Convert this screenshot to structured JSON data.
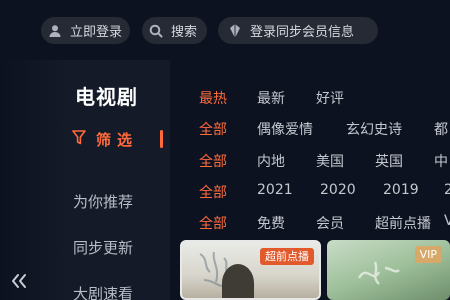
{
  "topbar": {
    "login_label": "立即登录",
    "search_label": "搜索",
    "sync_label": "登录同步会员信息"
  },
  "sidebar": {
    "title": "电视剧",
    "filter_label": "筛选",
    "items": [
      {
        "label": "为你推荐"
      },
      {
        "label": "同步更新"
      },
      {
        "label": "大剧速看"
      }
    ]
  },
  "filters": {
    "sort": [
      "最热",
      "最新",
      "好评"
    ],
    "genre": [
      "全部",
      "偶像爱情",
      "玄幻史诗",
      "都"
    ],
    "region": [
      "全部",
      "内地",
      "美国",
      "英国",
      "中"
    ],
    "year": [
      "全部",
      "2021",
      "2020",
      "2019",
      "2"
    ],
    "pay": [
      "全部",
      "免费",
      "会员",
      "超前点播",
      "V"
    ]
  },
  "posters": [
    {
      "badge": "超前点播"
    },
    {
      "badge": "VIP"
    }
  ],
  "colors": {
    "accent": "#ff6a3d",
    "background": "#0c1220",
    "pill": "#252a35",
    "vip_badge": "#d7a867",
    "pre_badge": "#e25a2c"
  },
  "icons": {
    "login": "user-icon",
    "search": "search-icon",
    "sync": "vip-diamond-icon",
    "filter": "funnel-icon",
    "back": "double-chevron-left-icon"
  }
}
